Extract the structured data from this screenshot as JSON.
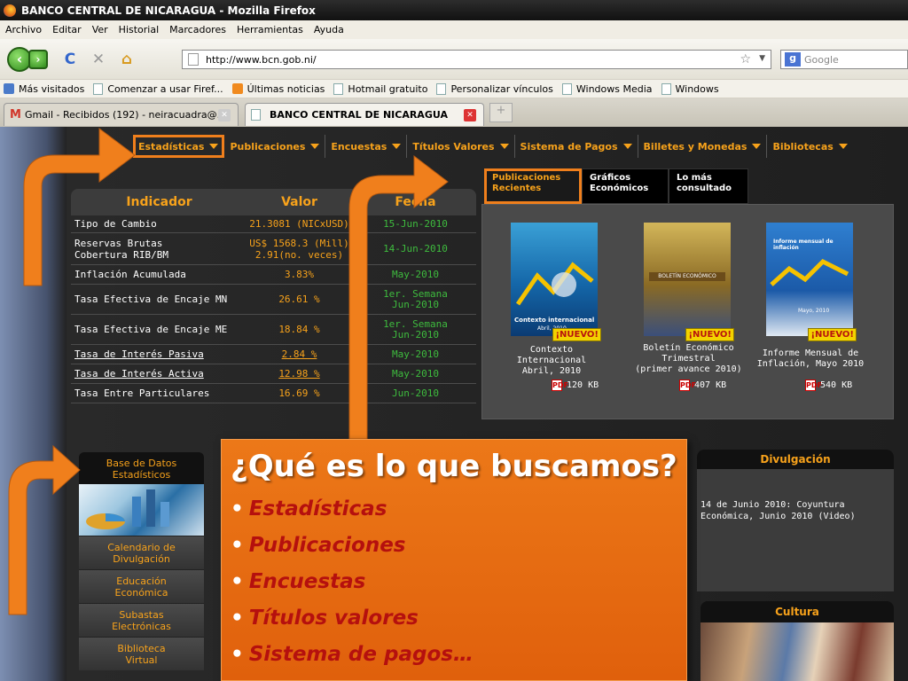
{
  "browser": {
    "window_title": "BANCO CENTRAL DE NICARAGUA - Mozilla Firefox",
    "menu": [
      "Archivo",
      "Editar",
      "Ver",
      "Historial",
      "Marcadores",
      "Herramientas",
      "Ayuda"
    ],
    "url": "http://www.bcn.gob.ni/",
    "search_placeholder": "Google",
    "bookmarks": [
      "Más visitados",
      "Comenzar a usar Firef...",
      "Últimas noticias",
      "Hotmail gratuito",
      "Personalizar vínculos",
      "Windows Media",
      "Windows"
    ],
    "tabs": [
      "Gmail - Recibidos (192) - neiracuadra@...",
      "BANCO CENTRAL DE NICARAGUA"
    ],
    "new_tab": "+"
  },
  "main_nav": [
    "Estadísticas",
    "Publicaciones",
    "Encuestas",
    "Títulos Valores",
    "Sistema de Pagos",
    "Billetes y Monedas",
    "Bibliotecas"
  ],
  "indicators": {
    "headers": [
      "Indicador",
      "Valor",
      "Fecha"
    ],
    "rows": [
      {
        "name": "Tipo de Cambio",
        "value": "21.3081 (NICxUSD)",
        "date": "15-Jun-2010"
      },
      {
        "name": "Reservas Brutas\nCobertura RIB/BM",
        "value": "US$ 1568.3 (Mill)\n2.91(no. veces)",
        "date": "14-Jun-2010"
      },
      {
        "name": "Inflación Acumulada",
        "value": "3.83%",
        "date": "May-2010"
      },
      {
        "name": "Tasa Efectiva de Encaje MN",
        "value": "26.61 %",
        "date": "1er. Semana\nJun-2010"
      },
      {
        "name": "Tasa Efectiva de Encaje ME",
        "value": "18.84 %",
        "date": "1er. Semana\nJun-2010"
      },
      {
        "name": "Tasa de Interés Pasiva",
        "value": "2.84 %",
        "date": "May-2010"
      },
      {
        "name": "Tasa de Interés Activa",
        "value": "12.98 %",
        "date": "May-2010"
      },
      {
        "name": "Tasa Entre Particulares",
        "value": "16.69 %",
        "date": "Jun-2010"
      }
    ]
  },
  "pub_tabs": [
    "Publicaciones Recientes",
    "Gráficos Económicos",
    "Lo más consultado"
  ],
  "publications": [
    {
      "title": "Contexto\nInternacional\nAbril, 2010",
      "size": "120 KB",
      "badge": "¡NUEVO!",
      "cover_text": "Contexto internacional",
      "cover_date": "Abril, 2010"
    },
    {
      "title": "Boletín Económico\nTrimestral\n(primer avance 2010)",
      "size": "407 KB",
      "badge": "¡NUEVO!",
      "cover_text": "BOLETÍN ECONÓMICO"
    },
    {
      "title": "Informe Mensual de\nInflación, Mayo 2010",
      "size": "540 KB",
      "badge": "¡NUEVO!",
      "cover_text": "Informe mensual de inflación",
      "cover_date": "Mayo, 2010"
    }
  ],
  "pdf_label": "PDF",
  "sidebar": {
    "header": "Base de Datos\nEstadísticos",
    "items": [
      "Calendario de\nDivulgación",
      "Educación\nEconómica",
      "Subastas\nElectrónicas",
      "Biblioteca\nVirtual"
    ]
  },
  "divulgacion": {
    "title": "Divulgación",
    "text": "14 de Junio 2010: Coyuntura\nEconómica, Junio 2010 (Video)"
  },
  "cultura": {
    "title": "Cultura"
  },
  "slide": {
    "question": "¿Qué es lo que buscamos?",
    "bullet": "•",
    "items": [
      "Estadísticas",
      "Publicaciones",
      "Encuestas",
      "Títulos valores",
      "Sistema de pagos…"
    ]
  },
  "colors": {
    "accent": "#f7a21b",
    "arrow": "#f07f1c",
    "date_green": "#3ebb3e",
    "slide_text": "#b5100e"
  }
}
